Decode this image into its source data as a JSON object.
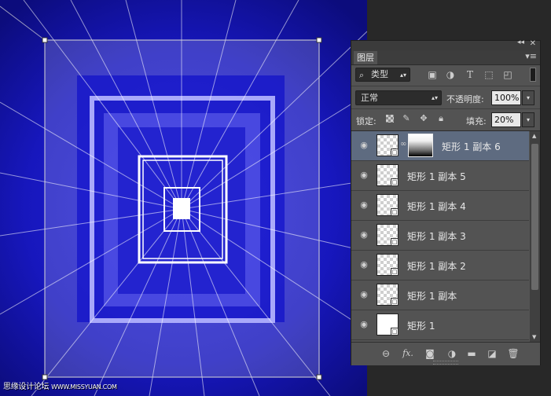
{
  "colors": {
    "canvas_blue": "#1a1ac8",
    "panel_bg": "#535353",
    "selected_row": "#5e6b80"
  },
  "panel": {
    "tab": "图层",
    "filter_kind": "类型",
    "blend_mode": "正常",
    "opacity_label": "不透明度:",
    "opacity_value": "100%",
    "lock_label": "锁定:",
    "fill_label": "填充:",
    "fill_value": "20%"
  },
  "layers": [
    {
      "name": "矩形 1 副本 6",
      "selected": true,
      "has_mask": true,
      "thumb": "transparent"
    },
    {
      "name": "矩形 1 副本 5",
      "selected": false,
      "has_mask": false,
      "thumb": "transparent"
    },
    {
      "name": "矩形 1 副本 4",
      "selected": false,
      "has_mask": false,
      "thumb": "transparent"
    },
    {
      "name": "矩形 1 副本 3",
      "selected": false,
      "has_mask": false,
      "thumb": "transparent"
    },
    {
      "name": "矩形 1 副本 2",
      "selected": false,
      "has_mask": false,
      "thumb": "transparent"
    },
    {
      "name": "矩形 1 副本",
      "selected": false,
      "has_mask": false,
      "thumb": "transparent"
    },
    {
      "name": "矩形 1",
      "selected": false,
      "has_mask": false,
      "thumb": "white"
    }
  ],
  "watermark": {
    "text": "思缘设计论坛",
    "url": "WWW.MISSYUAN.COM"
  }
}
